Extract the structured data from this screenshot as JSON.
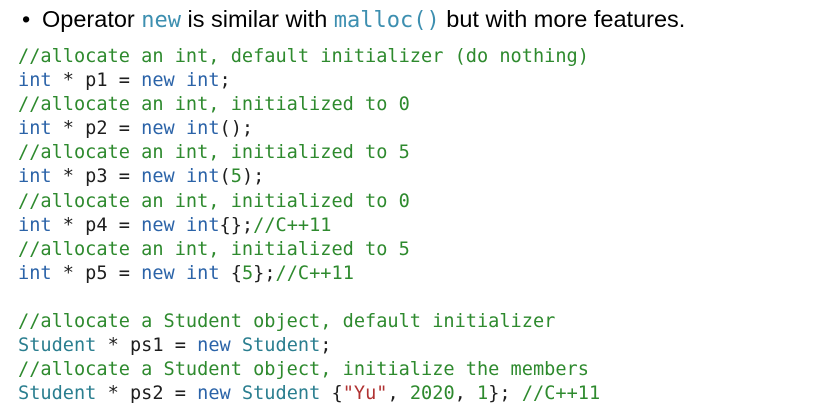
{
  "heading": {
    "bullet": "•",
    "text_before": "Operator ",
    "keyword": "new",
    "text_middle": " is similar with ",
    "function_name": "malloc()",
    "text_after": " but with more features."
  },
  "code": {
    "lines": [
      [
        {
          "t": "//allocate an int, default initializer (do nothing)",
          "k": "comment"
        }
      ],
      [
        {
          "t": "int",
          "k": "type"
        },
        {
          "t": " * p1 = ",
          "k": "plain"
        },
        {
          "t": "new",
          "k": "new"
        },
        {
          "t": " ",
          "k": "plain"
        },
        {
          "t": "int",
          "k": "type"
        },
        {
          "t": ";",
          "k": "plain"
        }
      ],
      [
        {
          "t": "//allocate an int, initialized to 0",
          "k": "comment"
        }
      ],
      [
        {
          "t": "int",
          "k": "type"
        },
        {
          "t": " * p2 = ",
          "k": "plain"
        },
        {
          "t": "new",
          "k": "new"
        },
        {
          "t": " ",
          "k": "plain"
        },
        {
          "t": "int",
          "k": "type"
        },
        {
          "t": "();",
          "k": "plain"
        }
      ],
      [
        {
          "t": "//allocate an int, initialized to 5",
          "k": "comment"
        }
      ],
      [
        {
          "t": "int",
          "k": "type"
        },
        {
          "t": " * p3 = ",
          "k": "plain"
        },
        {
          "t": "new",
          "k": "new"
        },
        {
          "t": " ",
          "k": "plain"
        },
        {
          "t": "int",
          "k": "type"
        },
        {
          "t": "(",
          "k": "plain"
        },
        {
          "t": "5",
          "k": "num"
        },
        {
          "t": ");",
          "k": "plain"
        }
      ],
      [
        {
          "t": "//allocate an int, initialized to 0",
          "k": "comment"
        }
      ],
      [
        {
          "t": "int",
          "k": "type"
        },
        {
          "t": " * p4 = ",
          "k": "plain"
        },
        {
          "t": "new",
          "k": "new"
        },
        {
          "t": " ",
          "k": "plain"
        },
        {
          "t": "int",
          "k": "type"
        },
        {
          "t": "{};",
          "k": "plain"
        },
        {
          "t": "//C++11",
          "k": "comment"
        }
      ],
      [
        {
          "t": "//allocate an int, initialized to 5",
          "k": "comment"
        }
      ],
      [
        {
          "t": "int",
          "k": "type"
        },
        {
          "t": " * p5 = ",
          "k": "plain"
        },
        {
          "t": "new",
          "k": "new"
        },
        {
          "t": " ",
          "k": "plain"
        },
        {
          "t": "int",
          "k": "type"
        },
        {
          "t": " {",
          "k": "plain"
        },
        {
          "t": "5",
          "k": "num"
        },
        {
          "t": "};",
          "k": "plain"
        },
        {
          "t": "//C++11",
          "k": "comment"
        }
      ],
      [],
      [
        {
          "t": "//allocate a Student object, default initializer",
          "k": "comment"
        }
      ],
      [
        {
          "t": "Student",
          "k": "class"
        },
        {
          "t": " * ps1 = ",
          "k": "plain"
        },
        {
          "t": "new",
          "k": "new"
        },
        {
          "t": " ",
          "k": "plain"
        },
        {
          "t": "Student",
          "k": "class"
        },
        {
          "t": ";",
          "k": "plain"
        }
      ],
      [
        {
          "t": "//allocate a Student object, initialize the members",
          "k": "comment"
        }
      ],
      [
        {
          "t": "Student",
          "k": "class"
        },
        {
          "t": " * ps2 = ",
          "k": "plain"
        },
        {
          "t": "new",
          "k": "new"
        },
        {
          "t": " ",
          "k": "plain"
        },
        {
          "t": "Student",
          "k": "class"
        },
        {
          "t": " {",
          "k": "plain"
        },
        {
          "t": "\"Yu\"",
          "k": "str"
        },
        {
          "t": ", ",
          "k": "plain"
        },
        {
          "t": "2020",
          "k": "num"
        },
        {
          "t": ", ",
          "k": "plain"
        },
        {
          "t": "1",
          "k": "num"
        },
        {
          "t": "}; ",
          "k": "plain"
        },
        {
          "t": "//C++11",
          "k": "comment"
        }
      ]
    ]
  },
  "colors": {
    "comment": "#2e8a2e",
    "type": "#2b63a8",
    "class": "#2a7e8f",
    "string": "#b03232",
    "inline_keyword": "#3d8fb0",
    "text": "#000000",
    "background": "#ffffff"
  }
}
